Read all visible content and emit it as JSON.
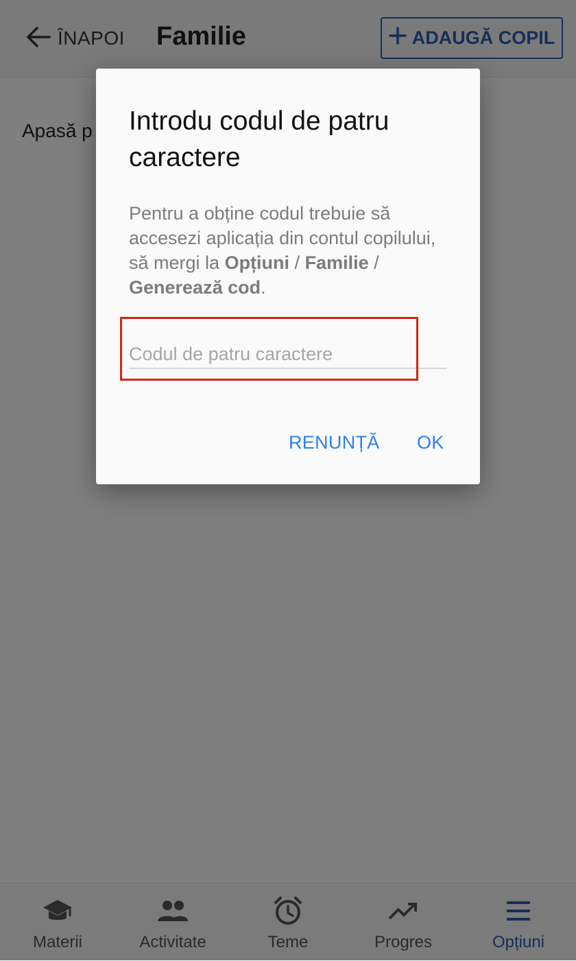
{
  "header": {
    "back_label": "ÎNAPOI",
    "title": "Familie",
    "add_child_label": "ADAUGĂ COPIL"
  },
  "content": {
    "hint_text": "Apasă p"
  },
  "dialog": {
    "title": "Introdu codul de patru caractere",
    "body_prefix": "Pentru a obține codul trebuie să accesezi aplicația din contul copilului, să mergi la ",
    "path_1": "Opțiuni",
    "separator": " / ",
    "path_2": "Familie",
    "path_3": "Generează cod",
    "body_suffix": ".",
    "input_value": "",
    "input_placeholder": "Codul de patru caractere",
    "cancel_label": "RENUNȚĂ",
    "ok_label": "OK"
  },
  "bottom_nav": {
    "items": [
      {
        "label": "Materii",
        "icon": "graduation-cap-icon"
      },
      {
        "label": "Activitate",
        "icon": "people-icon"
      },
      {
        "label": "Teme",
        "icon": "alarm-clock-icon"
      },
      {
        "label": "Progres",
        "icon": "trending-up-icon"
      },
      {
        "label": "Opțiuni",
        "icon": "menu-icon",
        "active": true
      }
    ]
  },
  "colors": {
    "accent": "#2a5db0",
    "link_blue": "#2f80ed",
    "highlight_red": "#d3250f"
  }
}
